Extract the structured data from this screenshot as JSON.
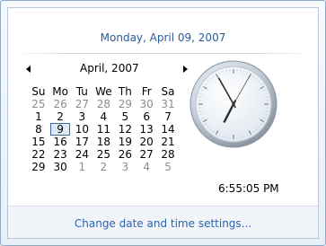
{
  "header": {
    "date_text": "Monday, April 09, 2007"
  },
  "calendar": {
    "month_label": "April, 2007",
    "weekday_headers": [
      "Su",
      "Mo",
      "Tu",
      "We",
      "Th",
      "Fr",
      "Sa"
    ],
    "weeks": [
      [
        {
          "d": "25",
          "m": true
        },
        {
          "d": "26",
          "m": true
        },
        {
          "d": "27",
          "m": true
        },
        {
          "d": "28",
          "m": true
        },
        {
          "d": "29",
          "m": true
        },
        {
          "d": "30",
          "m": true
        },
        {
          "d": "31",
          "m": true
        }
      ],
      [
        {
          "d": "1"
        },
        {
          "d": "2"
        },
        {
          "d": "3"
        },
        {
          "d": "4"
        },
        {
          "d": "5"
        },
        {
          "d": "6"
        },
        {
          "d": "7"
        }
      ],
      [
        {
          "d": "8"
        },
        {
          "d": "9",
          "sel": true
        },
        {
          "d": "10"
        },
        {
          "d": "11"
        },
        {
          "d": "12"
        },
        {
          "d": "13"
        },
        {
          "d": "14"
        }
      ],
      [
        {
          "d": "15"
        },
        {
          "d": "16"
        },
        {
          "d": "17"
        },
        {
          "d": "18"
        },
        {
          "d": "19"
        },
        {
          "d": "20"
        },
        {
          "d": "21"
        }
      ],
      [
        {
          "d": "22"
        },
        {
          "d": "23"
        },
        {
          "d": "24"
        },
        {
          "d": "25"
        },
        {
          "d": "26"
        },
        {
          "d": "27"
        },
        {
          "d": "28"
        }
      ],
      [
        {
          "d": "29"
        },
        {
          "d": "30"
        },
        {
          "d": "1",
          "m": true
        },
        {
          "d": "2",
          "m": true
        },
        {
          "d": "3",
          "m": true
        },
        {
          "d": "4",
          "m": true
        },
        {
          "d": "5",
          "m": true
        }
      ]
    ]
  },
  "clock": {
    "hour": 6,
    "minute": 55,
    "second": 5
  },
  "time_text": "6:55:05 PM",
  "footer": {
    "link_label": "Change date and time settings..."
  },
  "colors": {
    "accent": "#2b5a99",
    "link": "#2a64ad",
    "muted": "#8c8c8c"
  }
}
